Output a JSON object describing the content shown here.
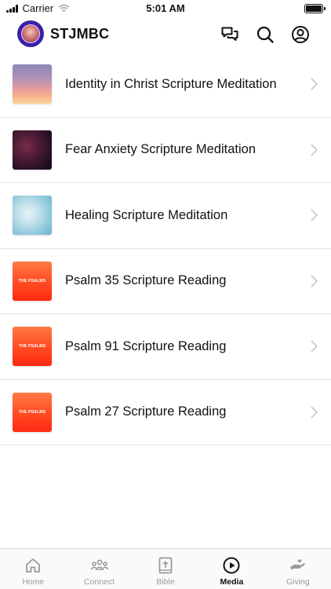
{
  "status_bar": {
    "carrier": "Carrier",
    "time": "5:01 AM"
  },
  "header": {
    "brand": "STJMBC",
    "icons": [
      "chat-icon",
      "search-icon",
      "account-icon"
    ]
  },
  "media_items": [
    {
      "title": "Identity in Christ Scripture Meditation",
      "thumb_label": ""
    },
    {
      "title": "Fear Anxiety Scripture Meditation",
      "thumb_label": ""
    },
    {
      "title": "Healing Scripture Meditation",
      "thumb_label": ""
    },
    {
      "title": "Psalm 35 Scripture Reading",
      "thumb_label": "THE PSALMS"
    },
    {
      "title": "Psalm 91 Scripture Reading",
      "thumb_label": "THE PSALMS"
    },
    {
      "title": "Psalm 27 Scripture Reading",
      "thumb_label": "THE PSALMS"
    }
  ],
  "tabs": [
    {
      "label": "Home",
      "icon": "home-icon",
      "active": false
    },
    {
      "label": "Connect",
      "icon": "people-icon",
      "active": false
    },
    {
      "label": "Bible",
      "icon": "bible-icon",
      "active": false
    },
    {
      "label": "Media",
      "icon": "play-icon",
      "active": true
    },
    {
      "label": "Giving",
      "icon": "giving-hand-icon",
      "active": false
    }
  ],
  "colors": {
    "active_tab": "#111111",
    "inactive_tab": "#9a9a9a",
    "logo_bg": "#3c1fa8",
    "psalms_gradient_top": "#ff6a3d",
    "psalms_gradient_bottom": "#ff2a12"
  }
}
